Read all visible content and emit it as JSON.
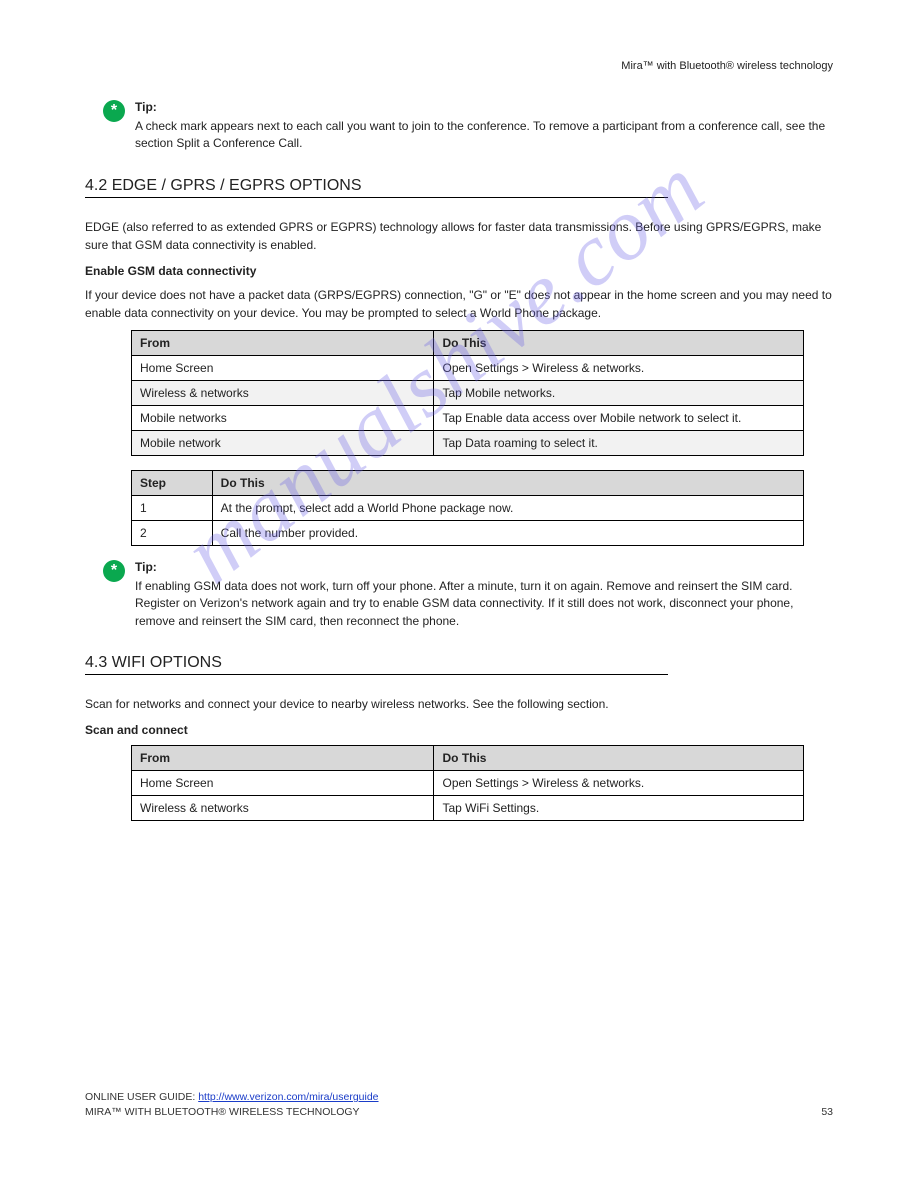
{
  "header": {
    "right": "Mira™ with Bluetooth® wireless technology"
  },
  "tip1": {
    "label": "Tip:",
    "text": "A check mark appears next to each call you want to join to the conference. To remove a participant from a conference call, see the section Split a Conference Call."
  },
  "section42": {
    "title": "4.2 EDGE / GPRS / EGPRS OPTIONS",
    "intro": "EDGE (also referred to as extended GPRS or EGPRS) technology allows for faster data transmissions. Before using GPRS/EGPRS, make sure that GSM data connectivity is enabled.",
    "sub": "Enable GSM data connectivity",
    "desc": "If your device does not have a packet data (GRPS/EGPRS) connection, \"G\" or \"E\" does not appear in the home screen and you may need to enable data connectivity on your device. You may be prompted to select a World Phone package.",
    "table1": {
      "headers": [
        "From",
        "Do This"
      ],
      "rows": [
        [
          "Home Screen",
          "Open Settings > Wireless & networks."
        ],
        [
          "Wireless & networks",
          "Tap Mobile networks."
        ],
        [
          "Mobile networks",
          "Tap Enable data access over Mobile network to select it."
        ],
        [
          "Mobile network",
          "Tap Data roaming to select it."
        ]
      ],
      "alt": [
        false,
        true,
        false,
        true
      ]
    },
    "table2": {
      "headers": [
        "Step",
        "Do This"
      ],
      "rows": [
        [
          "1",
          "At the prompt, select add a World Phone package now."
        ],
        [
          "2",
          "Call the number provided."
        ]
      ]
    }
  },
  "tip2": {
    "label": "Tip:",
    "text": "If enabling GSM data does not work, turn off your phone. After a minute, turn it on again. Remove and reinsert the SIM card. Register on Verizon's network again and try to enable GSM data connectivity. If it still does not work, disconnect your phone, remove and reinsert the SIM card, then reconnect the phone."
  },
  "section43": {
    "title": "4.3 WIFI OPTIONS",
    "intro": "Scan for networks and connect your device to nearby wireless networks. See the following section.",
    "sub": "Scan and connect",
    "table": {
      "headers": [
        "From",
        "Do This"
      ],
      "rows": [
        [
          "Home Screen",
          "Open Settings > Wireless & networks."
        ],
        [
          "Wireless & networks",
          "Tap WiFi Settings."
        ]
      ]
    }
  },
  "footer": {
    "line1_pre": "ONLINE USER GUIDE: ",
    "line1_link": "http://www.verizon.com/mira/userguide",
    "line2_left": "MIRA™ WITH BLUETOOTH® WIRELESS TECHNOLOGY",
    "line2_right": "53"
  },
  "watermark": "manualshive.com"
}
